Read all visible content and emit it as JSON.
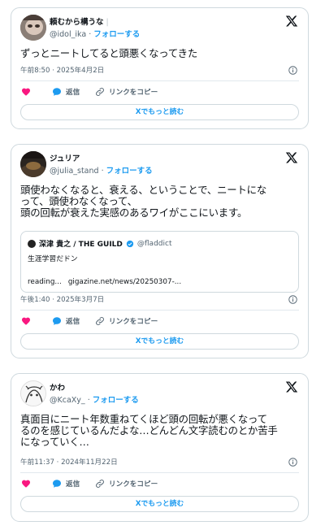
{
  "common": {
    "follow_label": "フォローする",
    "reply_label": "返信",
    "copy_link_label": "リンクをコピー",
    "read_more_label": "Xでもっと読む",
    "dot": "·",
    "like_color": "#f91880",
    "accent": "#1d9bf0"
  },
  "tweets": [
    {
      "name": "頼むから構うな",
      "name_extra": "|",
      "handle": "@idol_ika",
      "text": "ずっとニートしてると頭悪くなってきた",
      "timestamp": "午前8:50 · 2025年4月2日"
    },
    {
      "name": "ジュリア",
      "handle": "@julia_stand",
      "text": "頭使わなくなると、衰える、ということで、ニートにな\nって、頭使わなくなって、\n頭の回転が衰えた実感のあるワイがここにいます。",
      "quote": {
        "name": "深津 貴之 / THE GUILD",
        "handle": "@fladdict",
        "text": "生涯学習だドン",
        "reading": "reading...",
        "link": "gigazine.net/news/20250307-..."
      },
      "timestamp": "午後1:40 · 2025年3月7日"
    },
    {
      "name": "かわ",
      "handle": "@KcaXy_",
      "text": "真面目にニート年数重ねてくほど頭の回転が悪くなって\nるのを感じているんだよな…どんどん文字読むのとか苦手\nになっていく…",
      "timestamp": "午前11:37 · 2024年11月22日"
    }
  ]
}
